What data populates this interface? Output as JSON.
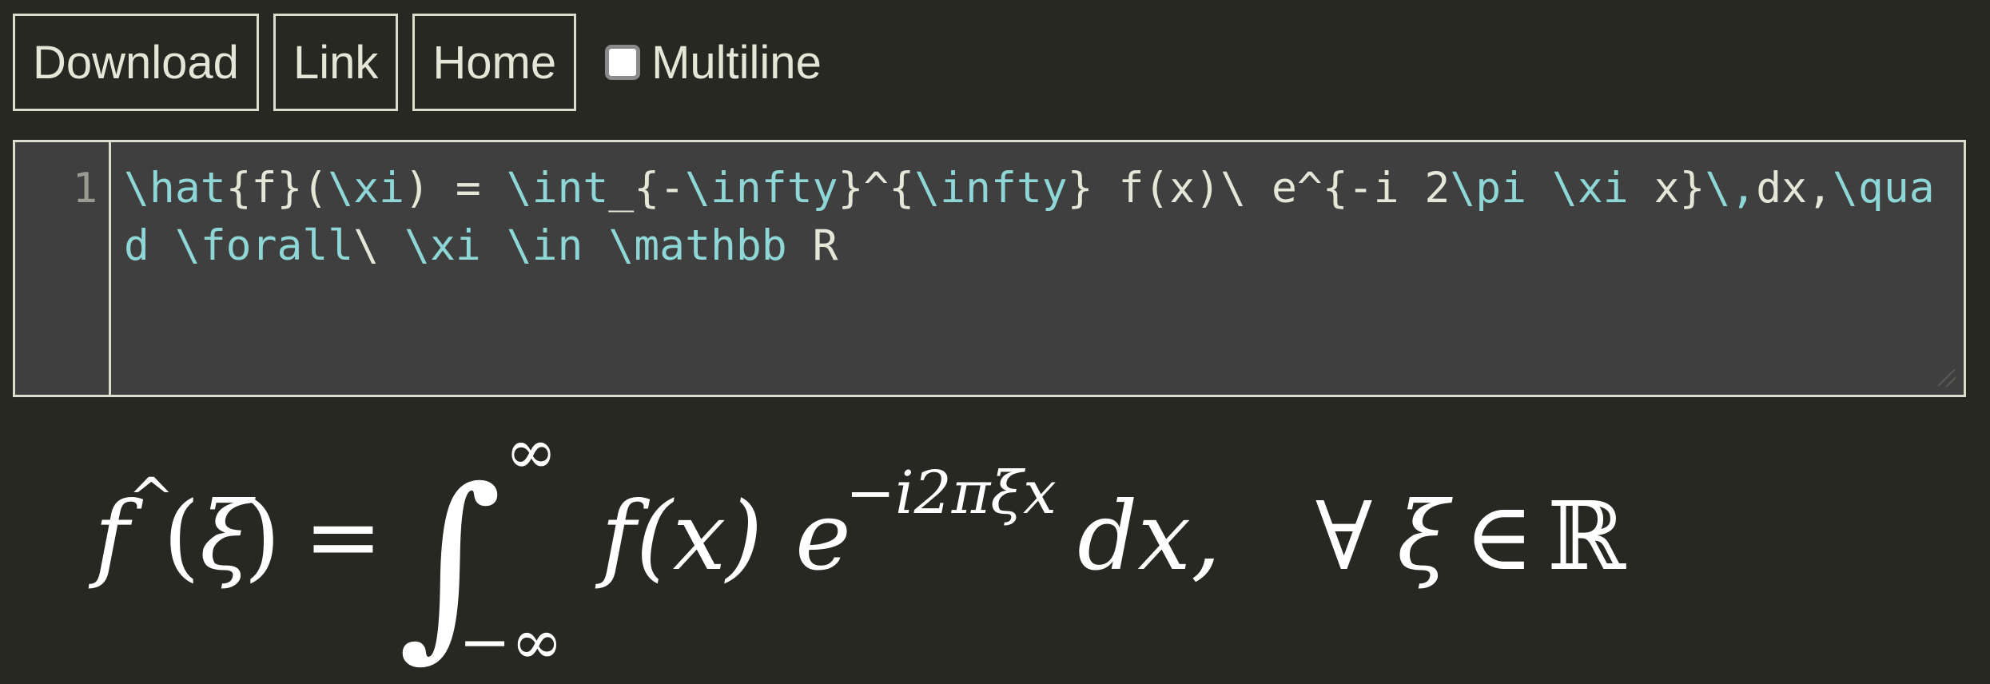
{
  "toolbar": {
    "download_label": "Download",
    "link_label": "Link",
    "home_label": "Home",
    "multiline_label": "Multiline",
    "multiline_checked": false
  },
  "editor": {
    "line_number": "1",
    "code_tokens": [
      {
        "t": "\\hat",
        "cmd": true
      },
      {
        "t": "{f}(",
        "cmd": false
      },
      {
        "t": "\\xi",
        "cmd": true
      },
      {
        "t": ") = ",
        "cmd": false
      },
      {
        "t": "\\int",
        "cmd": true
      },
      {
        "t": "_{-",
        "cmd": false
      },
      {
        "t": "\\infty",
        "cmd": true
      },
      {
        "t": "}^{",
        "cmd": false
      },
      {
        "t": "\\infty",
        "cmd": true
      },
      {
        "t": "} f(x)\\ e^{-i 2",
        "cmd": false
      },
      {
        "t": "\\pi",
        "cmd": true
      },
      {
        "t": " ",
        "cmd": false
      },
      {
        "t": "\\xi",
        "cmd": true
      },
      {
        "t": " x}",
        "cmd": false
      },
      {
        "t": "\\,",
        "cmd": true
      },
      {
        "t": "dx,",
        "cmd": false
      },
      {
        "t": "\\quad",
        "cmd": true
      },
      {
        "t": " ",
        "cmd": false
      },
      {
        "t": "\\forall",
        "cmd": true
      },
      {
        "t": "\\ ",
        "cmd": false
      },
      {
        "t": "\\xi",
        "cmd": true
      },
      {
        "t": " ",
        "cmd": false
      },
      {
        "t": "\\in",
        "cmd": true
      },
      {
        "t": " ",
        "cmd": false
      },
      {
        "t": "\\mathbb",
        "cmd": true
      },
      {
        "t": " R",
        "cmd": false
      }
    ]
  },
  "rendered": {
    "f_hat": "f",
    "hat": "^",
    "lparen": "(",
    "xi": "ξ",
    "rparen": ")",
    "equals": "=",
    "integral": "∫",
    "upper_limit": "∞",
    "lower_limit": "−∞",
    "fx": "f(x)",
    "e": "e",
    "exponent": "−i2πξx",
    "dx": "dx,",
    "forall": "∀",
    "xi2": "ξ",
    "in": "∈",
    "reals": "ℝ"
  },
  "colors": {
    "background": "#272822",
    "editor_background": "#3f3f3f",
    "command_color": "#8fd6d6",
    "text_color": "#e6e6d8"
  }
}
